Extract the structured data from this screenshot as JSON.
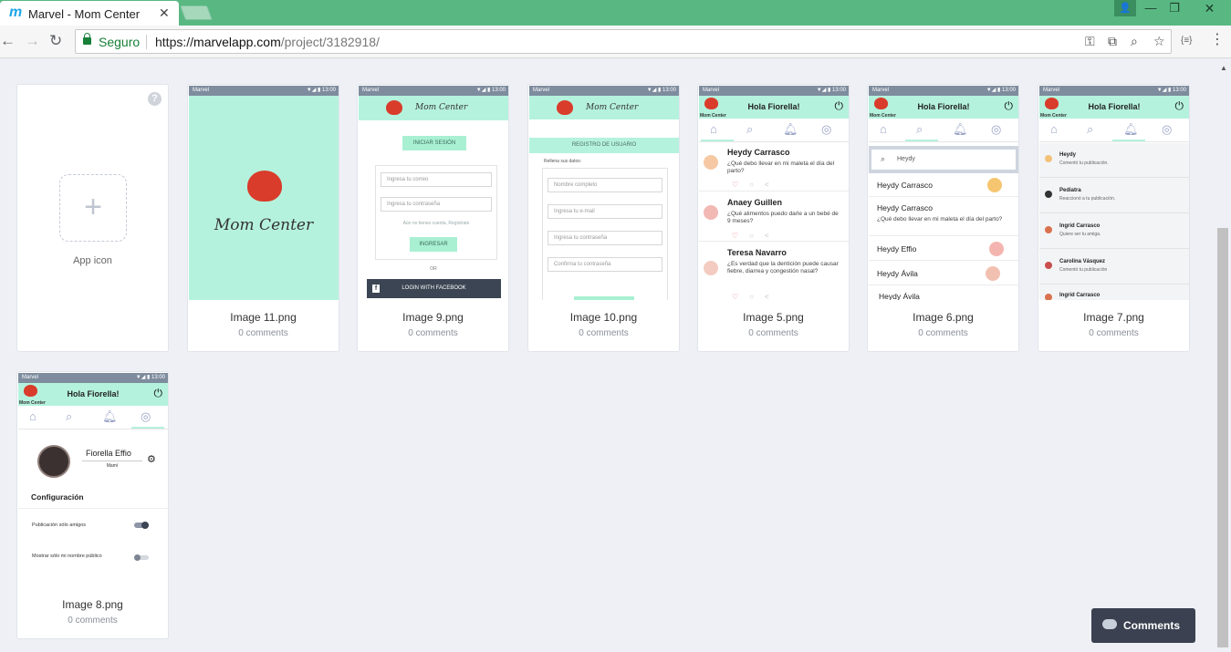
{
  "browser": {
    "tab_logo": "m",
    "tab_title": "Marvel - Mom Center",
    "tab_close": "✕",
    "window_minimize": "—",
    "window_restore": "❐",
    "window_close": "✕",
    "secure_label": "Seguro",
    "url_scheme": "https://",
    "url_host": "marvelapp.com",
    "url_path": "/project/3182918/"
  },
  "app_icon_card": {
    "plus": "+",
    "label": "App icon",
    "help": "?"
  },
  "screens": [
    {
      "name": "Image 11.png",
      "comments": "0 comments"
    },
    {
      "name": "Image 9.png",
      "comments": "0 comments"
    },
    {
      "name": "Image 10.png",
      "comments": "0 comments"
    },
    {
      "name": "Image 5.png",
      "comments": "0 comments"
    },
    {
      "name": "Image 6.png",
      "comments": "0 comments"
    },
    {
      "name": "Image 7.png",
      "comments": "0 comments"
    },
    {
      "name": "Image 8.png",
      "comments": "0 comments"
    }
  ],
  "phone": {
    "carrier": "Marvel",
    "time": "▼◢ ▮ 13:00",
    "brand": "Mom Center",
    "greeting": "Hola Fiorella!",
    "logo_caption": "Mom Center"
  },
  "login": {
    "signin_button": "INICIAR SESIÓN",
    "email_placeholder": "Ingresa tu correo",
    "password_placeholder": "Ingresa tu contraseña",
    "no_account": "Aún no tienes cuenta, Regístrate",
    "submit": "INGRESAR",
    "or": "OR",
    "facebook": "LOGIN WITH FACEBOOK"
  },
  "register": {
    "title": "REGISTRO DE USUARIO",
    "prompt": "Rellena sus datos:",
    "fields": [
      "Nombre completo",
      "Ingresa tu e-mail",
      "Ingresa tu contraseña",
      "Confirma tu contraseña"
    ]
  },
  "feed": [
    {
      "name": "Heydy Carrasco",
      "text": "¿Qué debo llevar en mi maleta el día del parto?"
    },
    {
      "name": "Anaey Guillen",
      "text": "¿Qué alimentos puedo darle a un bebé de 9 meses?"
    },
    {
      "name": "Teresa Navarro",
      "text": "¿Es verdad que la dentición puede causar fiebre, diarrea y congestión nasal?"
    }
  ],
  "search": {
    "query": "Heydy",
    "results": [
      {
        "name": "Heydy Carrasco",
        "text": ""
      },
      {
        "name": "Heydy Carrasco",
        "text": "¿Qué debo llevar en mi maleta el día del parto?"
      },
      {
        "name": "Heydy Effio",
        "text": ""
      },
      {
        "name": "Heydy Ávila",
        "text": ""
      },
      {
        "name": "Heydy Ávila",
        "text": ""
      }
    ]
  },
  "notifications": [
    {
      "name": "Heydy",
      "text": "Comentó tu publicación."
    },
    {
      "name": "Pediatra",
      "text": "Reaccionó a tu publicación."
    },
    {
      "name": "Ingrid Carrasco",
      "text": "Quiere ser tu amiga."
    },
    {
      "name": "Carolina Vásquez",
      "text": "Comentó tu publicación"
    },
    {
      "name": "Ingrid Carrasco",
      "text": ""
    }
  ],
  "profile": {
    "name": "Fiorella Effio",
    "role": "Mamí",
    "settings_title": "Configuración",
    "options": [
      "Publicación sólo amigos",
      "Mostrar sólo mi nombre público"
    ]
  },
  "comments_button": "Comments",
  "colors": {
    "chrome_green": "#59b882",
    "mint": "#b5f2dd",
    "heart_red": "#d93c2b",
    "page_bg": "#eef0f5",
    "comments_bg": "#3b4150"
  }
}
